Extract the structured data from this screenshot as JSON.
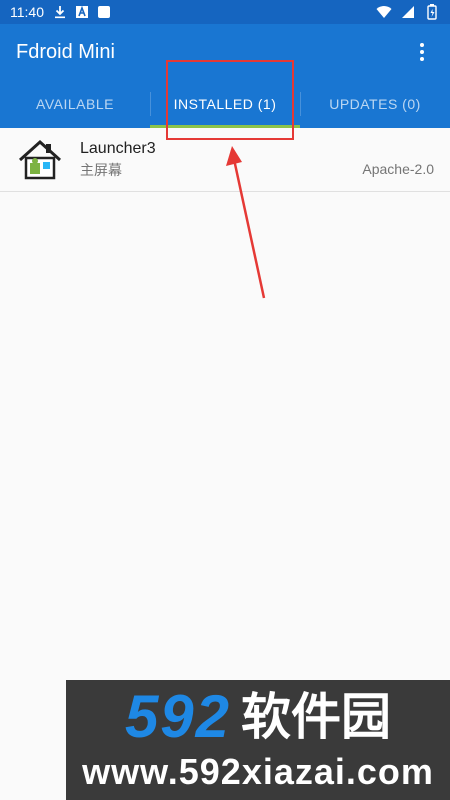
{
  "status_bar": {
    "time": "11:40",
    "left_icons": [
      "download-icon",
      "a-notification-icon",
      "square-notification-icon"
    ],
    "right_icons": [
      "wifi-icon",
      "signal-icon",
      "battery-icon"
    ]
  },
  "app_bar": {
    "title": "Fdroid Mini",
    "menu_icon": "more-vert-icon"
  },
  "tabs": [
    {
      "label": "AVAILABLE",
      "active": false
    },
    {
      "label": "INSTALLED (1)",
      "active": true
    },
    {
      "label": "UPDATES (0)",
      "active": false
    }
  ],
  "apps": [
    {
      "name": "Launcher3",
      "summary": "主屏幕",
      "license": "Apache-2.0",
      "icon": "house-icon"
    }
  ],
  "watermark": {
    "number": "592",
    "chinese": "软件园",
    "url": "www.592xiazai.com"
  },
  "colors": {
    "status_bar": "#1565c0",
    "app_bar": "#1976d2",
    "tab_indicator": "#8bc34a",
    "annotation": "#e53935",
    "watermark_bg": "#3a3a3a",
    "watermark_num": "#1e88e5"
  }
}
